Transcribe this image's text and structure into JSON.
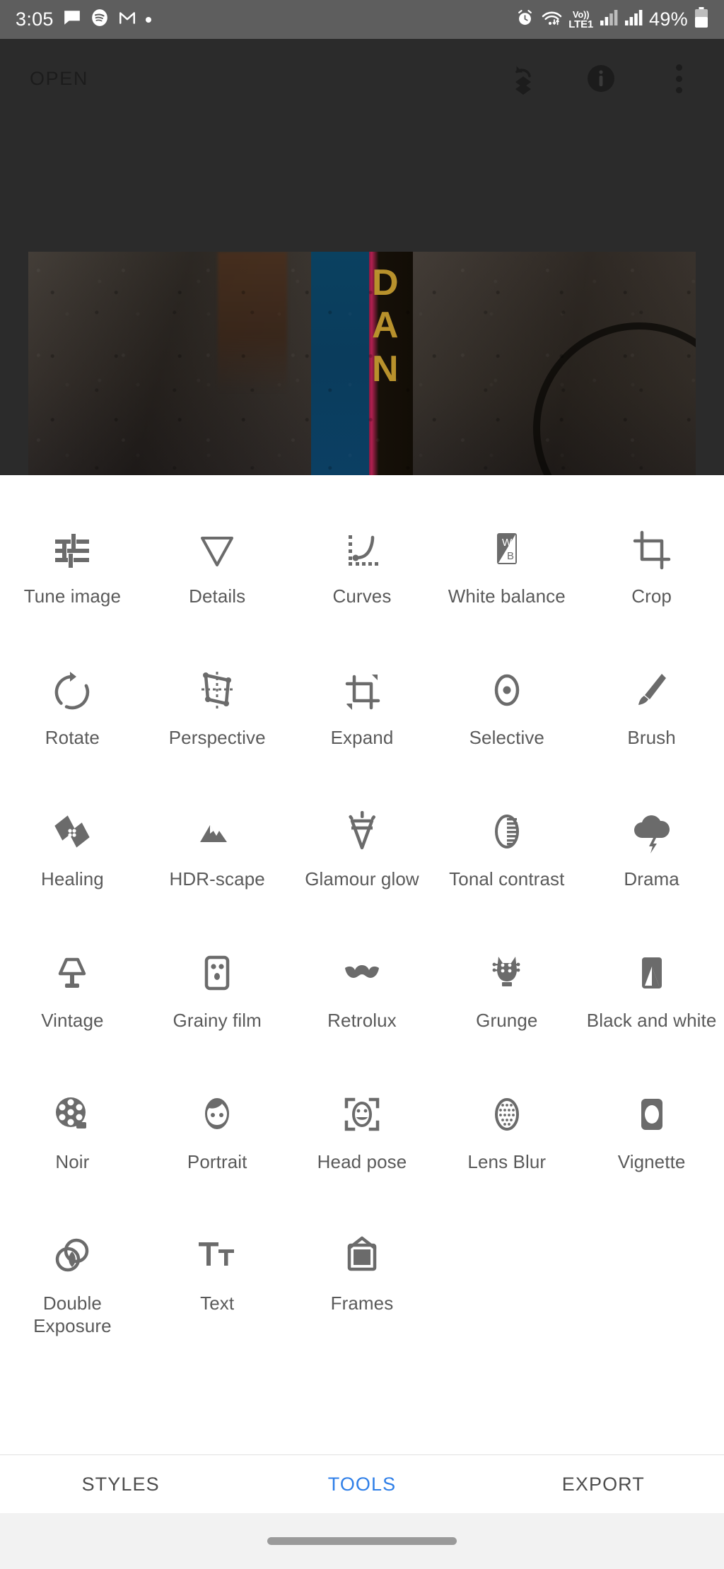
{
  "status_bar": {
    "time": "3:05",
    "left_icons": [
      "message-icon",
      "spotify-icon",
      "gmail-icon",
      "notification-dot-icon"
    ],
    "alarm_icon": "alarm-icon",
    "wifi_icon": "wifi-icon",
    "volte_top": "Vo))",
    "volte_bottom": "LTE1",
    "signal_icons": [
      "signal-bars-1-icon",
      "signal-bars-2-icon"
    ],
    "battery_percent": "49%",
    "battery_icon": "battery-icon",
    "background_color": "#5e5e5e"
  },
  "app_header": {
    "open_label": "OPEN",
    "actions": [
      {
        "name": "undo-stack-icon"
      },
      {
        "name": "info-icon"
      },
      {
        "name": "overflow-menu-icon"
      }
    ],
    "background_color": "#2b2b2b"
  },
  "preview": {
    "alt": "dark photo of a wall with a blue stripe and a yellow lettered stick",
    "letters": [
      "D",
      "A",
      "N"
    ]
  },
  "tools": {
    "rows": [
      [
        {
          "label": "Tune image",
          "icon": "tune-image-icon"
        },
        {
          "label": "Details",
          "icon": "details-icon"
        },
        {
          "label": "Curves",
          "icon": "curves-icon"
        },
        {
          "label": "White balance",
          "icon": "white-balance-icon"
        },
        {
          "label": "Crop",
          "icon": "crop-icon"
        }
      ],
      [
        {
          "label": "Rotate",
          "icon": "rotate-icon"
        },
        {
          "label": "Perspective",
          "icon": "perspective-icon"
        },
        {
          "label": "Expand",
          "icon": "expand-icon"
        },
        {
          "label": "Selective",
          "icon": "selective-icon"
        },
        {
          "label": "Brush",
          "icon": "brush-icon"
        }
      ],
      [
        {
          "label": "Healing",
          "icon": "healing-icon"
        },
        {
          "label": "HDR-scape",
          "icon": "hdr-scape-icon"
        },
        {
          "label": "Glamour glow",
          "icon": "glamour-glow-icon"
        },
        {
          "label": "Tonal contrast",
          "icon": "tonal-contrast-icon"
        },
        {
          "label": "Drama",
          "icon": "drama-icon"
        }
      ],
      [
        {
          "label": "Vintage",
          "icon": "vintage-icon"
        },
        {
          "label": "Grainy film",
          "icon": "grainy-film-icon"
        },
        {
          "label": "Retrolux",
          "icon": "retrolux-icon"
        },
        {
          "label": "Grunge",
          "icon": "grunge-icon"
        },
        {
          "label": "Black and white",
          "icon": "black-and-white-icon"
        }
      ],
      [
        {
          "label": "Noir",
          "icon": "noir-icon"
        },
        {
          "label": "Portrait",
          "icon": "portrait-icon"
        },
        {
          "label": "Head pose",
          "icon": "head-pose-icon"
        },
        {
          "label": "Lens Blur",
          "icon": "lens-blur-icon"
        },
        {
          "label": "Vignette",
          "icon": "vignette-icon"
        }
      ],
      [
        {
          "label": "Double Exposure",
          "icon": "double-exposure-icon"
        },
        {
          "label": "Text",
          "icon": "text-icon"
        },
        {
          "label": "Frames",
          "icon": "frames-icon"
        },
        {
          "label": "",
          "icon": ""
        },
        {
          "label": "",
          "icon": ""
        }
      ]
    ],
    "icon_color": "#6b6b6b",
    "label_color": "#5a5a5a"
  },
  "bottom_tabs": {
    "items": [
      {
        "label": "STYLES",
        "active": false
      },
      {
        "label": "TOOLS",
        "active": true
      },
      {
        "label": "EXPORT",
        "active": false
      }
    ],
    "active_color": "#2f7fe8",
    "inactive_color": "#4d4d4d"
  }
}
